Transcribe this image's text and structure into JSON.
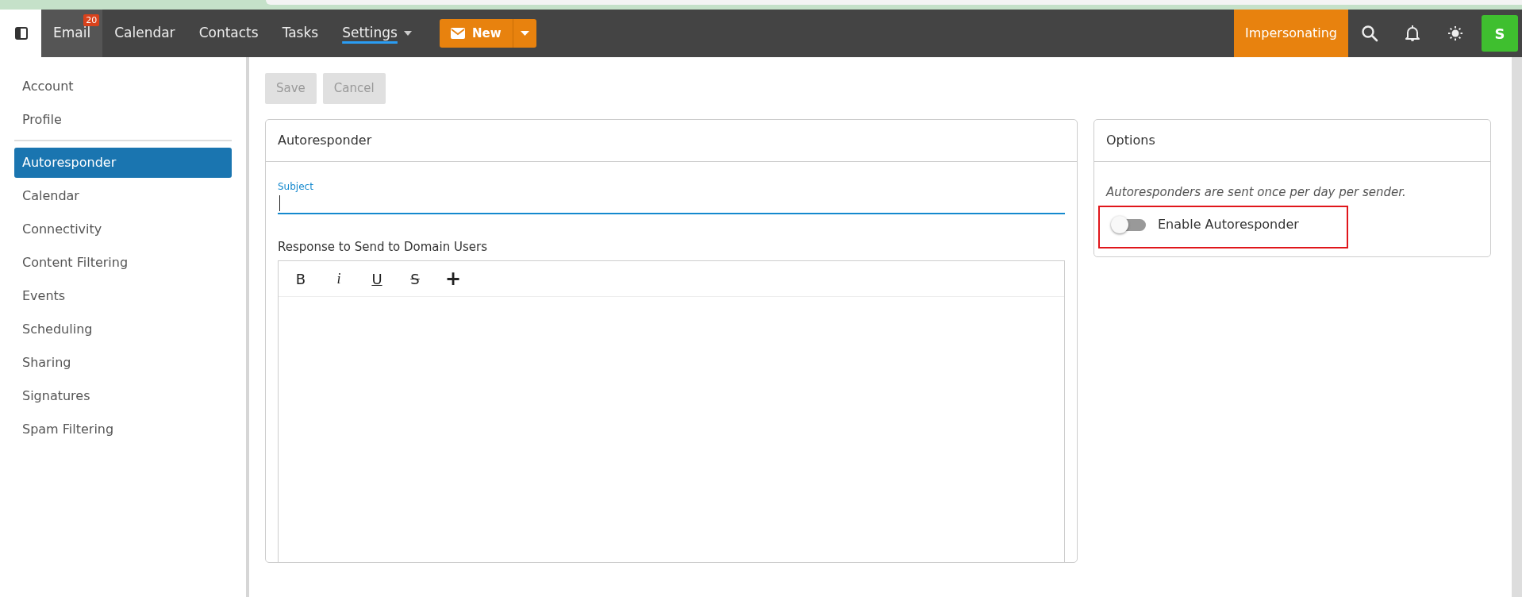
{
  "navbar": {
    "tabs": [
      {
        "label": "Email",
        "selected": true,
        "badge": "20",
        "dropdown": false,
        "underlined": false
      },
      {
        "label": "Calendar",
        "selected": false,
        "dropdown": false,
        "underlined": false
      },
      {
        "label": "Contacts",
        "selected": false,
        "dropdown": false,
        "underlined": false
      },
      {
        "label": "Tasks",
        "selected": false,
        "dropdown": false,
        "underlined": false
      },
      {
        "label": "Settings",
        "selected": false,
        "dropdown": true,
        "underlined": true
      }
    ],
    "new_button": {
      "label": "New"
    },
    "impersonating": {
      "label": "Impersonating"
    },
    "avatar": {
      "initial": "S"
    }
  },
  "sidebar": {
    "groups": [
      [
        {
          "label": "Account",
          "selected": false
        },
        {
          "label": "Profile",
          "selected": false
        }
      ],
      [
        {
          "label": "Autoresponder",
          "selected": true
        },
        {
          "label": "Calendar",
          "selected": false
        },
        {
          "label": "Connectivity",
          "selected": false
        },
        {
          "label": "Content Filtering",
          "selected": false
        },
        {
          "label": "Events",
          "selected": false
        },
        {
          "label": "Scheduling",
          "selected": false
        },
        {
          "label": "Sharing",
          "selected": false
        },
        {
          "label": "Signatures",
          "selected": false
        },
        {
          "label": "Spam Filtering",
          "selected": false
        }
      ]
    ]
  },
  "actions": [
    {
      "label": "Save",
      "disabled": true
    },
    {
      "label": "Cancel",
      "disabled": true
    }
  ],
  "editor_card": {
    "title": "Autoresponder",
    "subject": {
      "label": "Subject",
      "focused": true
    },
    "response_label": "Response to Send to Domain Users",
    "format_buttons": [
      {
        "kind": "bold",
        "label": "B"
      },
      {
        "kind": "italic",
        "label": "i"
      },
      {
        "kind": "underline",
        "label": "U"
      },
      {
        "kind": "strike",
        "label": "S"
      },
      {
        "kind": "plus",
        "label": "+"
      }
    ]
  },
  "options_card": {
    "title": "Options",
    "note": "Autoresponders are sent once per day per sender.",
    "toggle": {
      "label": "Enable Autoresponder",
      "on": false,
      "highlighted": true
    }
  }
}
